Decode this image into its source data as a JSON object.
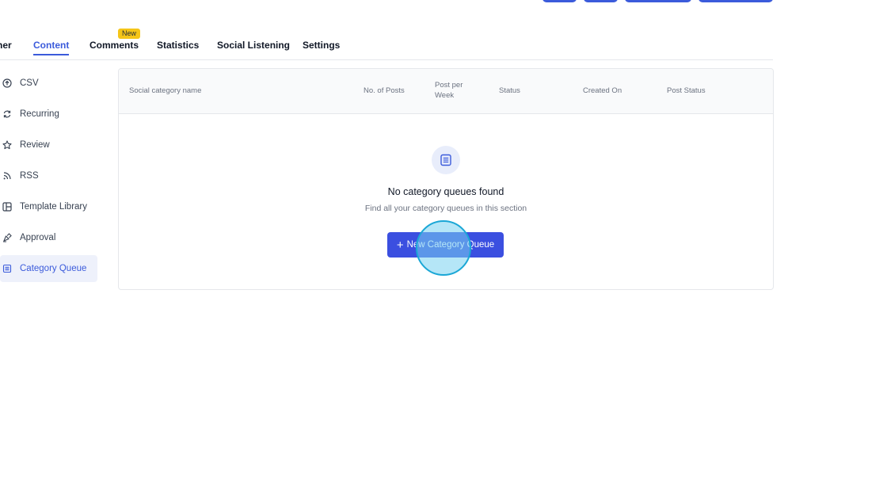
{
  "tabs": [
    {
      "label": "ner"
    },
    {
      "label": "Content"
    },
    {
      "label": "Comments",
      "badge": "New"
    },
    {
      "label": "Statistics"
    },
    {
      "label": "Social Listening"
    },
    {
      "label": "Settings"
    }
  ],
  "sidebar": {
    "items": [
      {
        "label": "CSV",
        "icon": "upload-circle-icon"
      },
      {
        "label": "Recurring",
        "icon": "refresh-icon"
      },
      {
        "label": "Review",
        "icon": "star-icon"
      },
      {
        "label": "RSS",
        "icon": "rss-icon"
      },
      {
        "label": "Template Library",
        "icon": "template-icon"
      },
      {
        "label": "Approval",
        "icon": "approval-icon"
      },
      {
        "label": "Category Queue",
        "icon": "queue-list-icon"
      }
    ]
  },
  "table": {
    "headers": [
      "Social category name",
      "No. of Posts",
      "Post per Week",
      "Status",
      "Created On",
      "Post Status"
    ]
  },
  "empty_state": {
    "title": "No category queues found",
    "subtitle": "Find all your category queues in this section",
    "button_plus": "+",
    "button_label": "New Category Queue"
  },
  "colors": {
    "accent": "#3b5bdb",
    "button": "#3b4fe0",
    "badge": "#f5c518",
    "click_indicator": "#1aa7d6"
  }
}
